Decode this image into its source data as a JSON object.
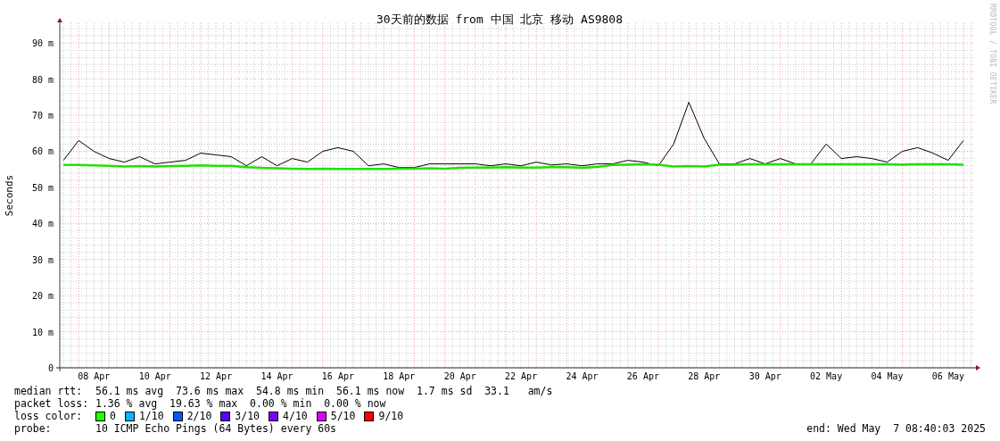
{
  "graph": {
    "credit": "RRDTOOL / TOBI OETIKER",
    "chart_data": {
      "type": "line",
      "title": "30天前的数据 from 中国 北京 移动 AS9808",
      "ylabel": "Seconds",
      "categories": [
        null,
        null,
        "08 Apr",
        null,
        null,
        null,
        "10 Apr",
        null,
        null,
        null,
        "12 Apr",
        null,
        null,
        null,
        "14 Apr",
        null,
        null,
        null,
        "16 Apr",
        null,
        null,
        null,
        "18 Apr",
        null,
        null,
        null,
        "20 Apr",
        null,
        null,
        null,
        "22 Apr",
        null,
        null,
        null,
        "24 Apr",
        null,
        null,
        null,
        "26 Apr",
        null,
        null,
        null,
        "28 Apr",
        null,
        null,
        null,
        "30 Apr",
        null,
        null,
        null,
        "02 May",
        null,
        null,
        null,
        "04 May",
        null,
        null,
        null,
        "06 May",
        null
      ],
      "series": [
        {
          "color": "#22e000",
          "values": [
            56.2,
            56.2,
            56.1,
            56.0,
            55.8,
            55.9,
            55.8,
            55.9,
            56.0,
            56.1,
            56.0,
            56.0,
            55.6,
            55.4,
            55.3,
            55.2,
            55.1,
            55.2,
            55.1,
            55.1,
            55.1,
            55.1,
            55.2,
            55.2,
            55.3,
            55.2,
            55.4,
            55.5,
            55.5,
            55.6,
            55.5,
            55.5,
            55.6,
            55.6,
            55.4,
            55.7,
            56.2,
            56.3,
            56.4,
            56.3,
            55.8,
            55.9,
            55.8,
            56.3,
            56.3,
            56.4,
            56.4,
            56.4,
            56.4,
            56.4,
            56.4,
            56.4,
            56.4,
            56.4,
            56.4,
            56.3,
            56.4,
            56.4,
            56.4,
            56.3
          ]
        },
        {
          "color": "#000000",
          "values": [
            57.5,
            63,
            60,
            58,
            57,
            58.5,
            56.5,
            57,
            57.5,
            59.5,
            59,
            58.5,
            56,
            58.5,
            56,
            58,
            57,
            60,
            61,
            60,
            56,
            56.5,
            55.5,
            55.5,
            56.5,
            56.5,
            56.5,
            56.5,
            56,
            56.5,
            56,
            57,
            56.2,
            56.5,
            56,
            56.5,
            56.5,
            57.5,
            57,
            56,
            62,
            73.6,
            63.6,
            56.5,
            56.5,
            58,
            56.5,
            58,
            56.5,
            56.5,
            62,
            58,
            58.5,
            58,
            57,
            60,
            61,
            59.5,
            57.5,
            63
          ]
        }
      ],
      "grid": true,
      "ylim": [
        0,
        95.5
      ],
      "yticks": [
        {
          "value": 0,
          "label": "0"
        },
        {
          "value": 10,
          "label": "10 m"
        },
        {
          "value": 20,
          "label": "20 m"
        },
        {
          "value": 30,
          "label": "30 m"
        },
        {
          "value": 40,
          "label": "40 m"
        },
        {
          "value": 50,
          "label": "50 m"
        },
        {
          "value": 60,
          "label": "60 m"
        },
        {
          "value": 70,
          "label": "70 m"
        },
        {
          "value": 80,
          "label": "80 m"
        },
        {
          "value": 90,
          "label": "90 m"
        }
      ]
    }
  },
  "legend": {
    "rows": [
      {
        "label": "median rtt:",
        "text": "56.1 ms avg  73.6 ms max  54.8 ms min  56.1 ms now  1.7 ms sd  33.1   am/s"
      },
      {
        "label": "packet loss:",
        "text": "1.36 % avg  19.63 % max  0.00 % min  0.00 % now"
      }
    ],
    "loss_color": {
      "label": "loss color:",
      "items": [
        {
          "label": "0",
          "color": "#26ff00"
        },
        {
          "label": "1/10",
          "color": "#00b8ff"
        },
        {
          "label": "2/10",
          "color": "#0059ff"
        },
        {
          "label": "3/10",
          "color": "#5e00ff"
        },
        {
          "label": "4/10",
          "color": "#7e00ff"
        },
        {
          "label": "5/10",
          "color": "#dd00ff"
        },
        {
          "label": "9/10",
          "color": "#ff0000"
        }
      ]
    },
    "probe": {
      "label": "probe:",
      "text": "10 ICMP Echo Pings (64 Bytes) every 60s"
    },
    "end": "end: Wed May  7 08:40:03 2025"
  }
}
